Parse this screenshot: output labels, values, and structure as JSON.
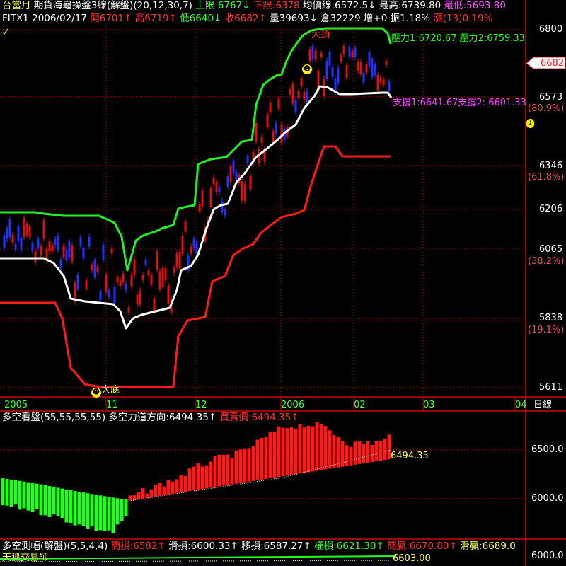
{
  "header": {
    "line1": [
      {
        "text": "台當月",
        "color": "#ffff66"
      },
      {
        "text": "期貨海龜操盤3線(解盤)(20,12,30,7)",
        "color": "#ffffff"
      },
      {
        "text": "上限:6767↓",
        "color": "#33ff33"
      },
      {
        "text": "下限:6378",
        "color": "#ff3333"
      },
      {
        "text": "均價線:6572.5↓",
        "color": "#ffffff"
      },
      {
        "text": "最高:6739.80",
        "color": "#ffffff"
      },
      {
        "text": "最低:5693.80",
        "color": "#ff55ff"
      }
    ],
    "line2": [
      {
        "text": "FITX1 2006/02/17",
        "color": "#ffffff"
      },
      {
        "text": "開6701↑",
        "color": "#ff3333"
      },
      {
        "text": "高6719↑",
        "color": "#ff3333"
      },
      {
        "text": "低6640↓",
        "color": "#33ff33"
      },
      {
        "text": "收6682↑",
        "color": "#ff3333"
      },
      {
        "text": "量39693↓",
        "color": "#ffffff"
      },
      {
        "text": "倉32229",
        "color": "#ffffff"
      },
      {
        "text": "增+0",
        "color": "#ffffff"
      },
      {
        "text": "振1.18%",
        "color": "#ffffff"
      },
      {
        "text": "漲(13)0.19%",
        "color": "#ff3333"
      }
    ]
  },
  "annotations": {
    "top_label": "大頂",
    "bottom_label": "大底",
    "resist": "壓力1:6720.67 壓力2:6759.33",
    "support": "支撐1:6641.67支撐2: 6601.33",
    "current_price": "6682",
    "checkmark": "✓"
  },
  "price_axis": [
    {
      "value": "6800",
      "pct": ""
    },
    {
      "value": "6573",
      "pct": "(80.9%)"
    },
    {
      "value": "6346",
      "pct": "(61.8%)"
    },
    {
      "value": "6206",
      "pct": ""
    },
    {
      "value": "6065",
      "pct": "(38.2%)"
    },
    {
      "value": "5838",
      "pct": "(19.1%)"
    },
    {
      "value": "5611",
      "pct": ""
    }
  ],
  "date_axis": [
    "2005",
    "11",
    "12",
    "2006",
    "02",
    "03",
    "04",
    "日線"
  ],
  "osc_panel": {
    "title_parts": [
      {
        "text": "多空看盤(55,55,55,55)",
        "color": "#ffffff"
      },
      {
        "text": "多空力道方向:6494.35↑",
        "color": "#ffffff"
      },
      {
        "text": "買賣價:6494.35↑",
        "color": "#ff3333"
      }
    ],
    "axis": [
      "6500.0",
      "6000.0"
    ],
    "value_label": "6494.35"
  },
  "bottom_panel": {
    "title_parts": [
      {
        "text": "多空測幅(解盤)(5,5,4,4)",
        "color": "#ffffff"
      },
      {
        "text": "簡損:6582↑",
        "color": "#ff3333"
      },
      {
        "text": "滑損:6600.33↑",
        "color": "#ffffff"
      },
      {
        "text": "移損:6587.27↑",
        "color": "#ffffff"
      },
      {
        "text": "權損:6621.30↑",
        "color": "#33ff33"
      },
      {
        "text": "簡贏:6670.80↑",
        "color": "#ff3333"
      },
      {
        "text": "滑贏:6689.0",
        "color": "#ffff66"
      }
    ],
    "axis": "6000.0",
    "footer": "天狐交易師",
    "value_label": "6603.00"
  },
  "colors": {
    "upper_line": "#22ee22",
    "lower_line": "#ff1a1a",
    "mid_line": "#ffffff",
    "candle_up": "#dd1111",
    "candle_down": "#2233ff",
    "bar_pos": "#ff1a1a",
    "bar_neg": "#22ff22",
    "grid": "#aa0000"
  },
  "chart_data": [
    {
      "type": "line",
      "title": "期貨海龜操盤3線(解盤)(20,12,30,7)",
      "x_range": [
        "2005",
        "2006/02/17"
      ],
      "ylim": [
        5611,
        6800
      ],
      "series": [
        {
          "name": "上限",
          "last": 6767
        },
        {
          "name": "下限",
          "last": 6378
        },
        {
          "name": "均價線",
          "last": 6572.5
        }
      ],
      "last_bar": {
        "date": "2006/02/17",
        "open": 6701,
        "high": 6719,
        "low": 6640,
        "close": 6682,
        "volume": 39693,
        "open_interest": 32229
      },
      "range_high": 6739.8,
      "range_low": 5693.8
    },
    {
      "type": "bar",
      "title": "多空看盤(55,55,55,55)",
      "ylim": [
        5900,
        6750
      ],
      "last": 6494.35
    }
  ]
}
